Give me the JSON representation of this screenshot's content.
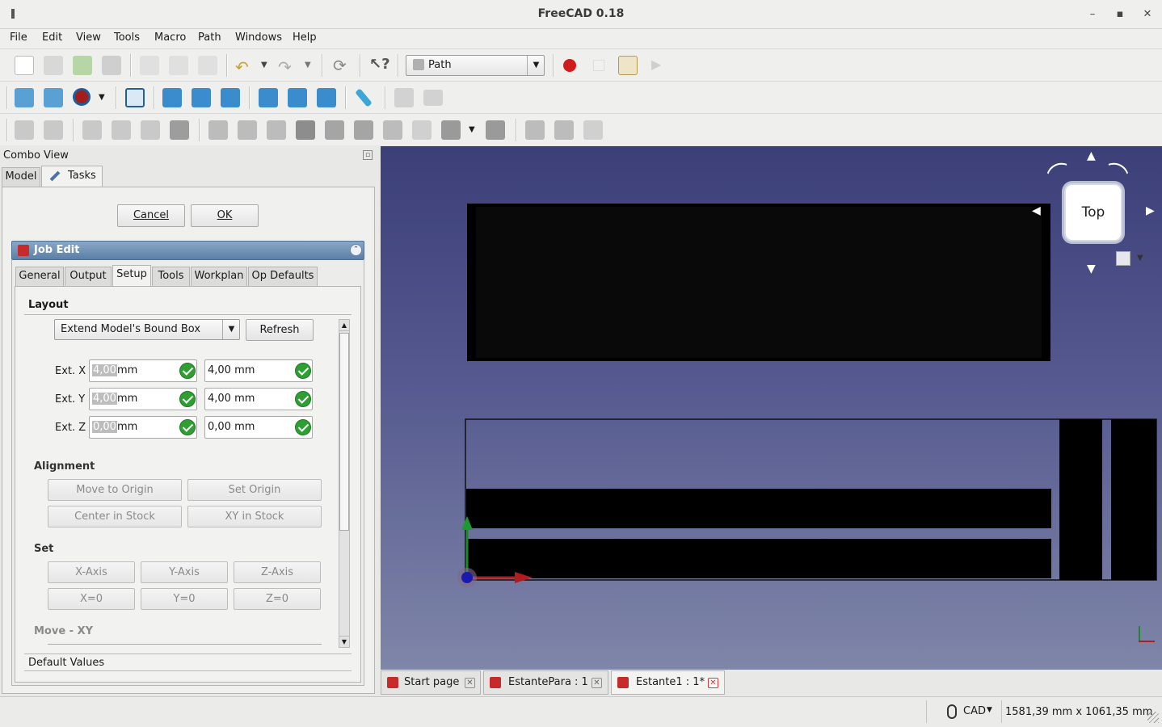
{
  "window": {
    "title": "FreeCAD 0.18"
  },
  "menu": [
    "File",
    "Edit",
    "View",
    "Tools",
    "Macro",
    "Path",
    "Windows",
    "Help"
  ],
  "toolbar": {
    "workbench": "Path"
  },
  "combo": {
    "title": "Combo View",
    "tab_model": "Model",
    "tab_tasks": "Tasks"
  },
  "task": {
    "cancel": "Cancel",
    "ok": "OK"
  },
  "job": {
    "title": "Job Edit",
    "tabs": [
      "General",
      "Output",
      "Setup",
      "Tools",
      "Workplan",
      "Op Defaults"
    ],
    "layout_label": "Layout",
    "layout_mode": "Extend Model's Bound Box",
    "refresh": "Refresh",
    "ext_x_label": "Ext. X",
    "ext_x_value": "4,00",
    "ext_x_unit": "mm",
    "ext_x2": "4,00 mm",
    "ext_y_label": "Ext. Y",
    "ext_y_value": "4,00",
    "ext_y_unit": "mm",
    "ext_y2": "4,00 mm",
    "ext_z_label": "Ext. Z",
    "ext_z_value": "0,00",
    "ext_z_unit": "mm",
    "ext_z2": "0,00 mm",
    "alignment": "Alignment",
    "move_origin": "Move to Origin",
    "set_origin": "Set Origin",
    "center_stock": "Center in Stock",
    "xy_stock": "XY in Stock",
    "set": "Set",
    "x_axis": "X-Axis",
    "y_axis": "Y-Axis",
    "z_axis": "Z-Axis",
    "x0": "X=0",
    "y0": "Y=0",
    "z0": "Z=0",
    "move_xy": "Move - XY",
    "default_values": "Default Values"
  },
  "navcube": {
    "face": "Top"
  },
  "doc_tabs": [
    {
      "label": "Start page"
    },
    {
      "label": "EstantePara : 1"
    },
    {
      "label": "Estante1 : 1*"
    }
  ],
  "status": {
    "nav_style": "CAD",
    "dimensions": "1581,39 mm x 1061,35 mm"
  }
}
